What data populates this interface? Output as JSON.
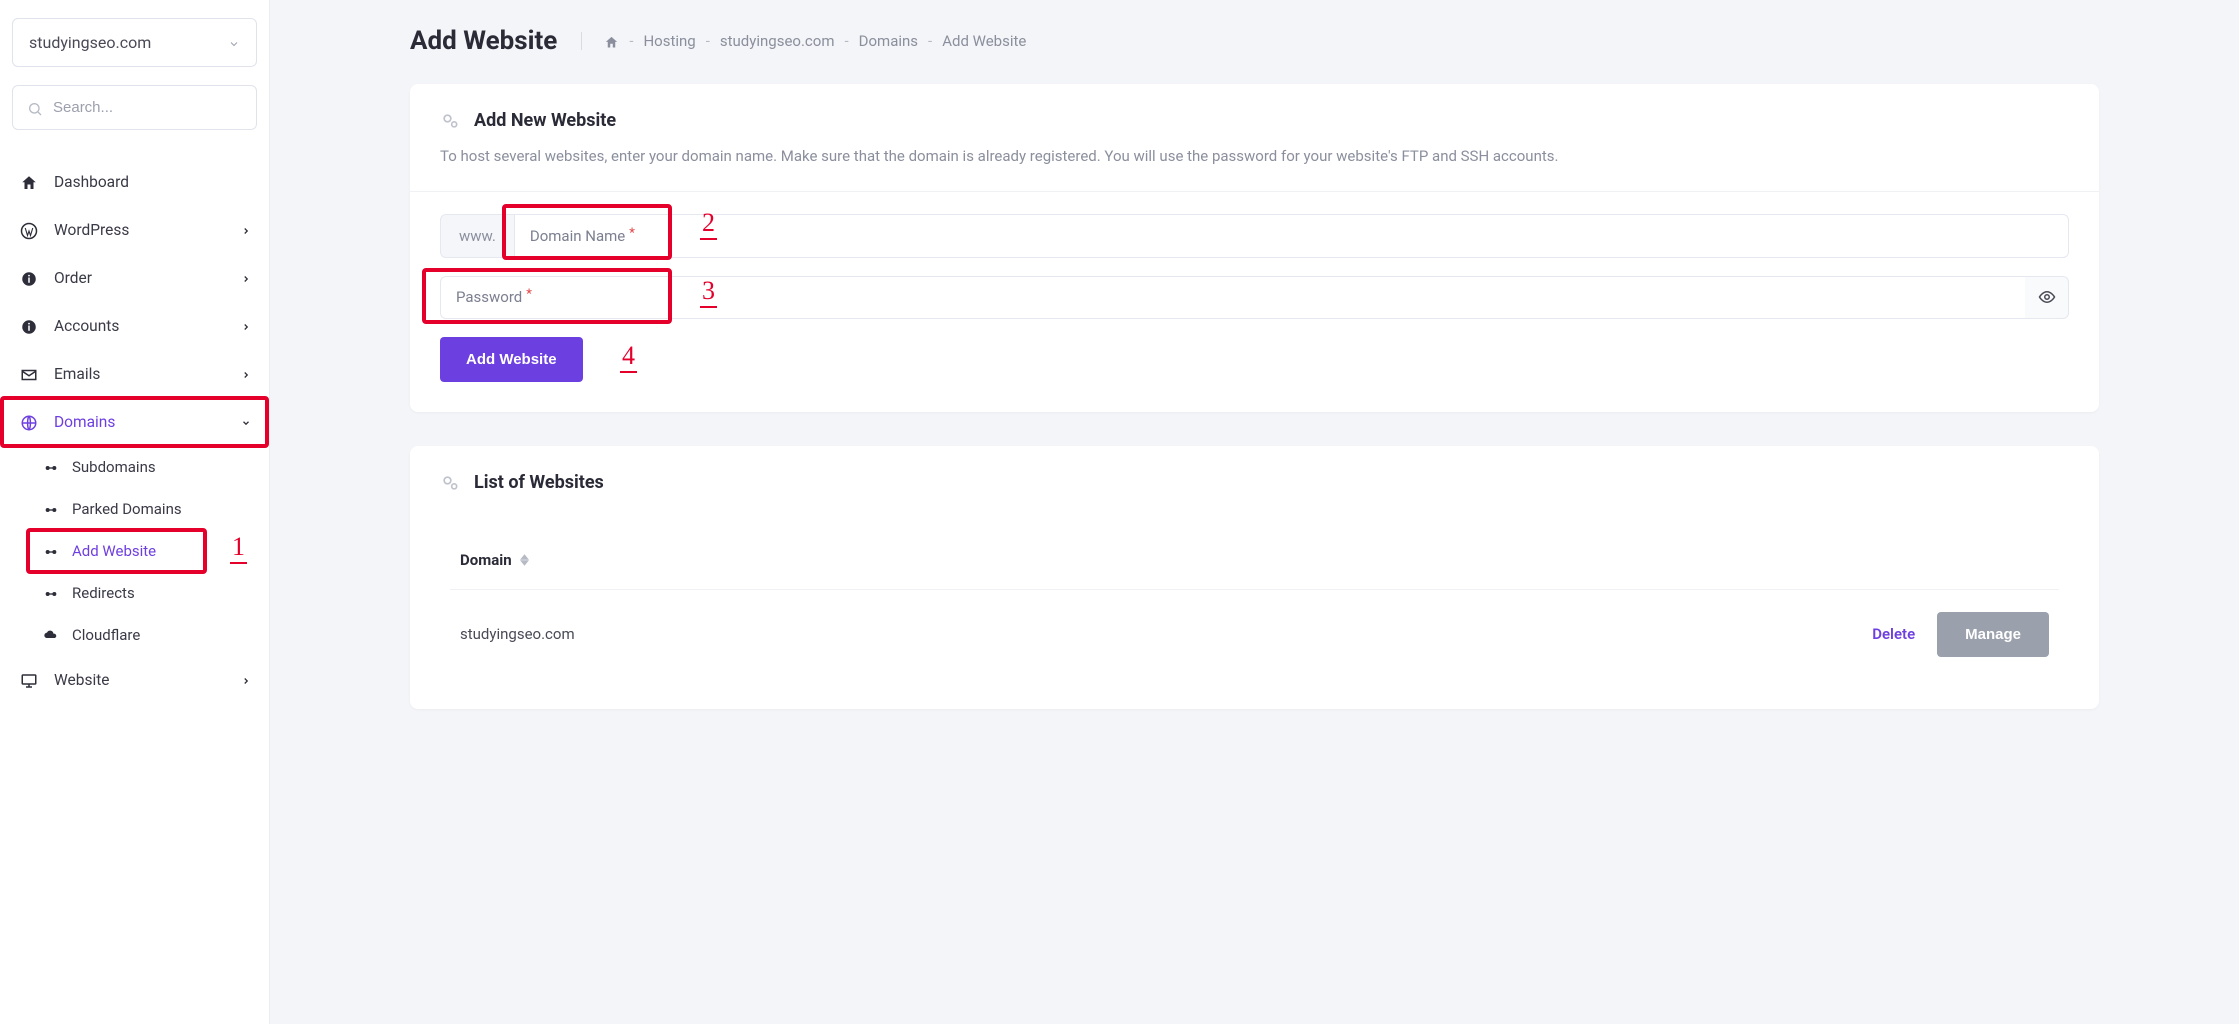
{
  "sidebar": {
    "selected_domain": "studyingseo.com",
    "search_placeholder": "Search...",
    "items": [
      {
        "icon": "home",
        "label": "Dashboard",
        "chev": false
      },
      {
        "icon": "wordpress",
        "label": "WordPress",
        "chev": true
      },
      {
        "icon": "info",
        "label": "Order",
        "chev": true
      },
      {
        "icon": "info",
        "label": "Accounts",
        "chev": true
      },
      {
        "icon": "mail",
        "label": "Emails",
        "chev": true
      },
      {
        "icon": "globe",
        "label": "Domains",
        "chev": true,
        "active": true,
        "down": true
      },
      {
        "icon": "monitor",
        "label": "Website",
        "chev": true
      }
    ],
    "domains_sub": [
      {
        "label": "Subdomains"
      },
      {
        "label": "Parked Domains"
      },
      {
        "label": "Add Website",
        "active": true
      },
      {
        "label": "Redirects"
      },
      {
        "label": "Cloudflare"
      }
    ]
  },
  "page": {
    "title": "Add Website",
    "crumbs": [
      "Hosting",
      "studyingseo.com",
      "Domains",
      "Add Website"
    ]
  },
  "add_card": {
    "title": "Add New Website",
    "desc": "To host several websites, enter your domain name. Make sure that the domain is already registered. You will use the password for your website's FTP and SSH accounts.",
    "prefix": "www.",
    "domain_label": "Domain Name",
    "password_label": "Password",
    "submit": "Add Website"
  },
  "list_card": {
    "title": "List of Websites",
    "col": "Domain",
    "rows": [
      {
        "domain": "studyingseo.com"
      }
    ],
    "delete": "Delete",
    "manage": "Manage"
  },
  "annotations": {
    "n1": "1",
    "n2": "2",
    "n3": "3",
    "n4": "4"
  }
}
